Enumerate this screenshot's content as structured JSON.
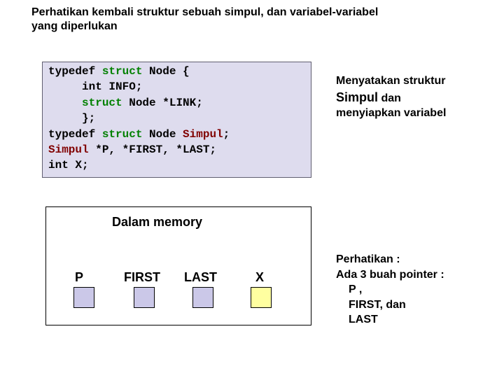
{
  "title": "Perhatikan kembali struktur sebuah simpul, dan variabel-variabel yang diperlukan",
  "code": {
    "l1a": "typedef ",
    "l1b": "struct",
    "l1c": " Node {",
    "l2": "     int INFO;",
    "l3a": "     ",
    "l3b": "struct",
    "l3c": " Node *LINK;",
    "l4": "     };",
    "l5a": "typedef ",
    "l5b": "struct",
    "l5c": " Node ",
    "l5d": "Simpul",
    "l5e": ";",
    "l6a": "Simpul",
    "l6b": " *P, *FIRST, *LAST;",
    "l7": "int X;"
  },
  "note1": {
    "line1": "Menyatakan struktur",
    "line2a": "Simpul",
    "line2b": " dan",
    "line3": "menyiapkan variabel"
  },
  "memory": {
    "title": "Dalam memory",
    "cells": {
      "p": "P",
      "first": "FIRST",
      "last": "LAST",
      "x": "X"
    }
  },
  "note2": {
    "line1": "Perhatikan :",
    "line2": "Ada 3 buah pointer :",
    "line3": "P ,",
    "line4": "FIRST, dan",
    "line5": "LAST"
  }
}
